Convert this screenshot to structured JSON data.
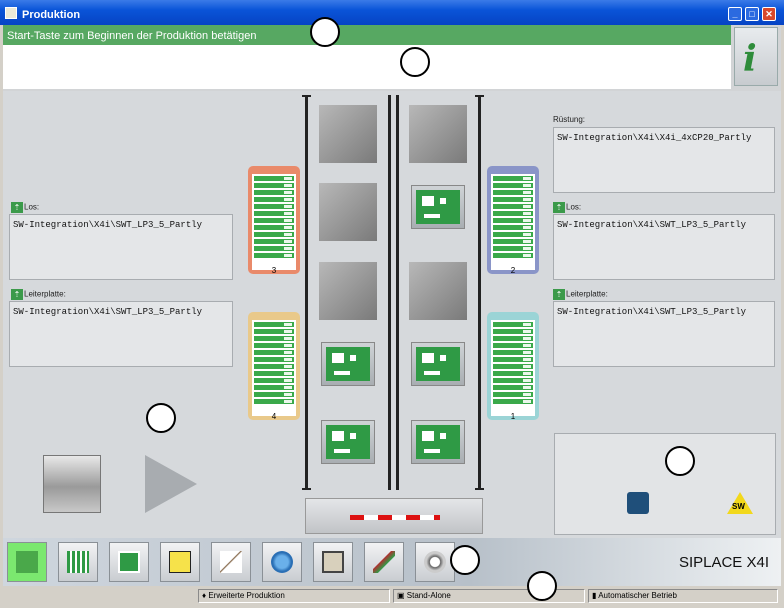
{
  "window": {
    "title": "Produktion"
  },
  "message": {
    "text": "Start-Taste zum Beginnen der Produktion betätigen"
  },
  "left": {
    "los_label": "Los:",
    "los_value": "SW-Integration\\X4i\\SWT_LP3_5_Partly",
    "leiterplatte_label": "Leiterplatte:",
    "leiterplatte_value": "SW-Integration\\X4i\\SWT_LP3_5_Partly"
  },
  "right": {
    "ruestung_label": "Rüstung:",
    "ruestung_value": "SW-Integration\\X4i\\X4i_4xCP20_Partly",
    "los_label": "Los:",
    "los_value": "SW-Integration\\X4i\\SWT_LP3_5_Partly",
    "leiterplatte_label": "Leiterplatte:",
    "leiterplatte_value": "SW-Integration\\X4i\\SWT_LP3_5_Partly"
  },
  "feeders": [
    {
      "num": "3",
      "color": "#e98a6a"
    },
    {
      "num": "4",
      "color": "#e9c98a"
    },
    {
      "num": "2",
      "color": "#8a95c8"
    },
    {
      "num": "1",
      "color": "#9bd4d6"
    }
  ],
  "status_icons": {
    "operator": "operator-icon",
    "warning": "sw-warning-icon",
    "warning_text": "SW"
  },
  "toolbar": {
    "brand": "SIPLACE X4I",
    "buttons": [
      "production-icon",
      "grid-icon",
      "pcb-icon",
      "alarm-icon",
      "chart-icon",
      "camera-icon",
      "oil-can-icon",
      "nozzle-icon",
      "settings-hand-icon"
    ]
  },
  "statusbar": {
    "mode1": "Erweiterte Produktion",
    "mode2": "Stand-Alone",
    "mode3": "Automatischer Betrieb"
  },
  "colors": {
    "accent": "#57a862",
    "pcb": "#2f9a45",
    "titlebar": "#0a54d8"
  }
}
